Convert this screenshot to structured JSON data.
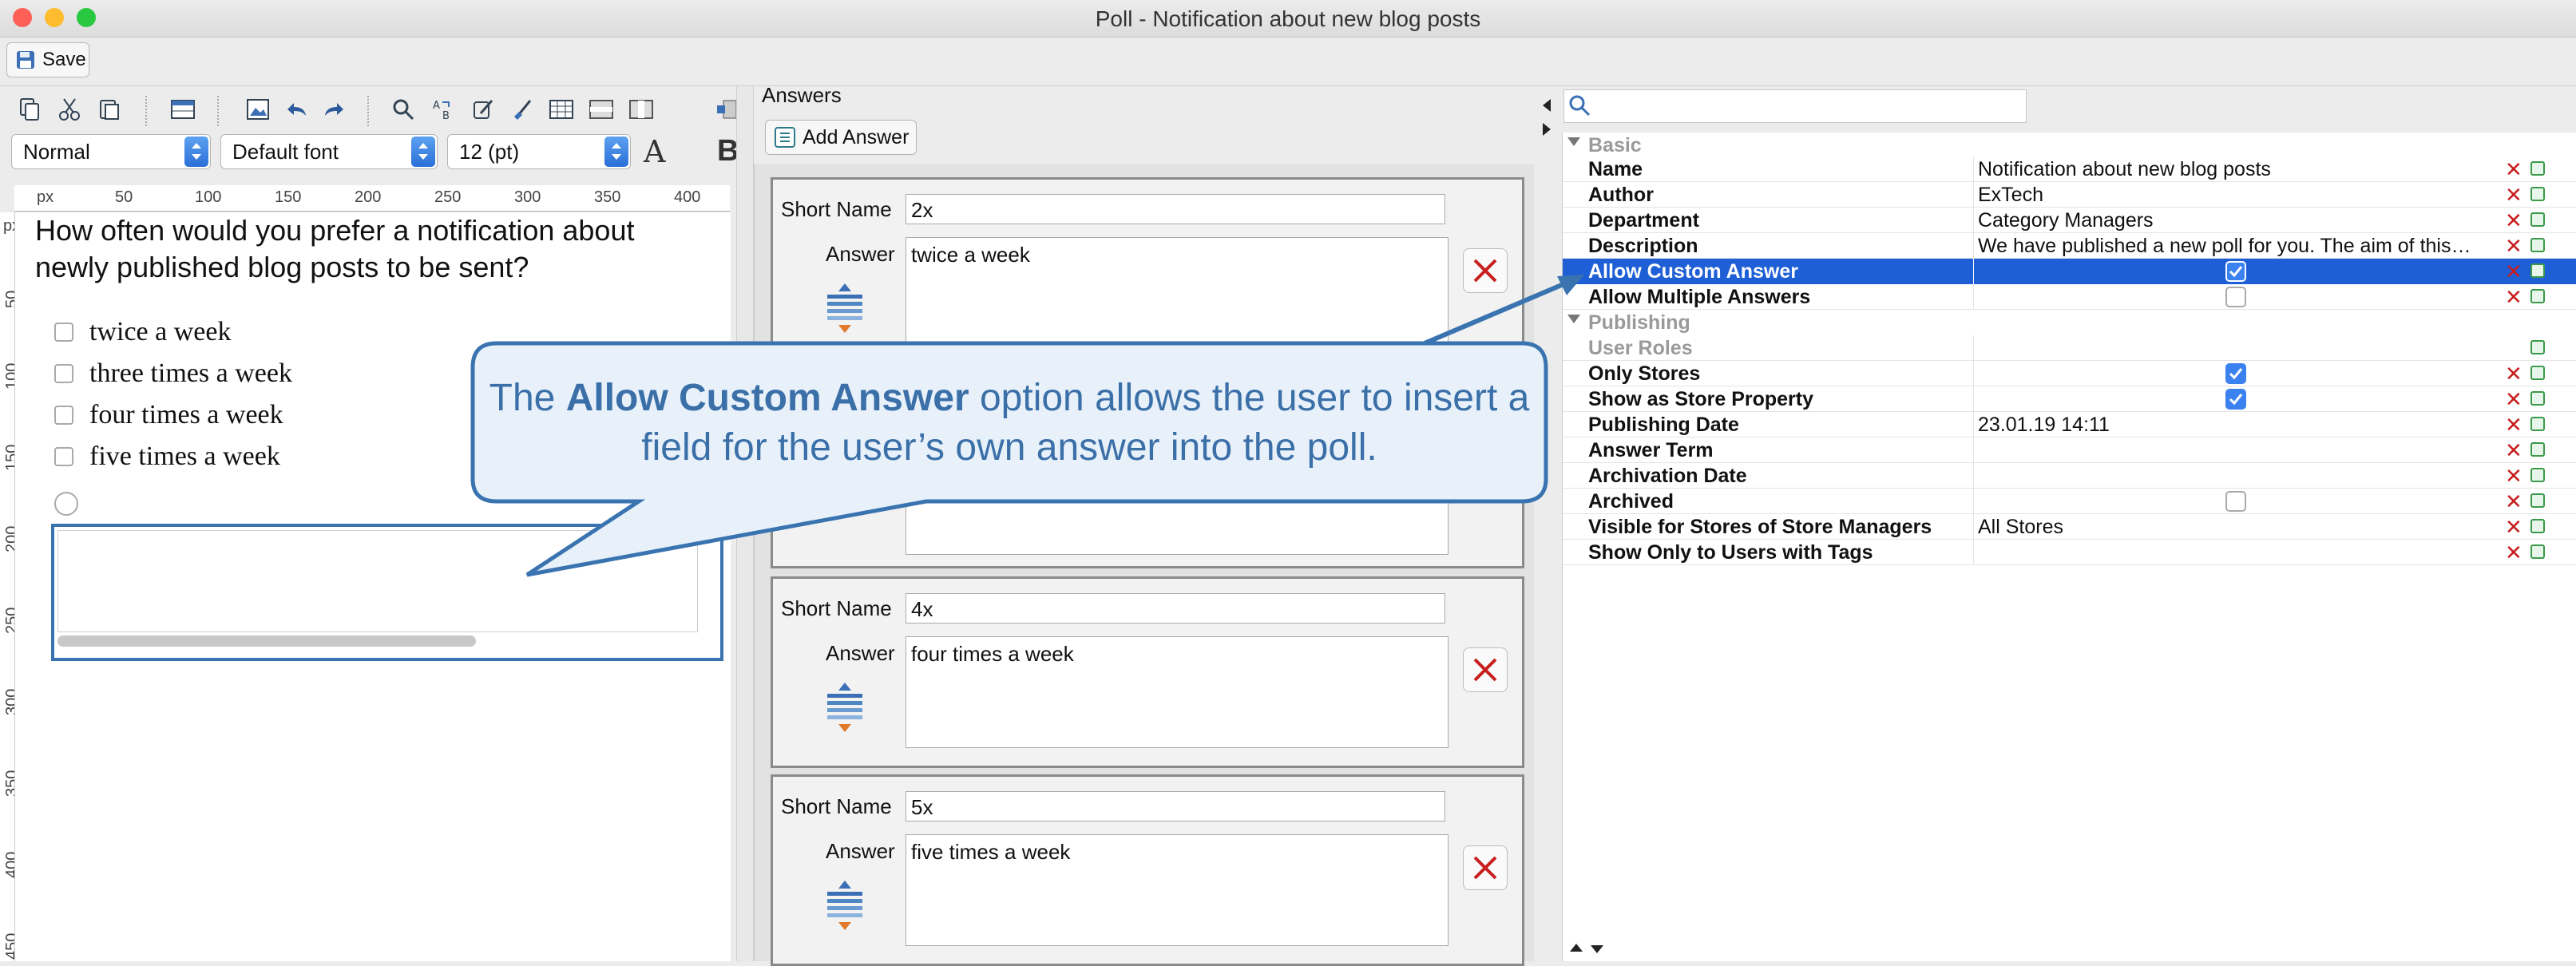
{
  "window": {
    "title": "Poll - Notification about new blog posts"
  },
  "toolbar": {
    "save_label": "Save",
    "style_select": "Normal",
    "font_select": "Default font",
    "size_select": "12 (pt)"
  },
  "editor": {
    "ruler_unit": "px",
    "ruler_top_ticks": [
      "50",
      "100",
      "150",
      "200",
      "250",
      "300",
      "350",
      "400"
    ],
    "ruler_left_ticks": [
      "50",
      "100",
      "150",
      "200",
      "250",
      "300",
      "350",
      "400",
      "450"
    ],
    "question": "How often would you prefer a notification about newly published blog posts to be sent?",
    "options": [
      "twice a week",
      "three times a week",
      "four times a week",
      "five times a week"
    ]
  },
  "answers": {
    "legend": "Answers",
    "add_label": "Add Answer",
    "short_name_label": "Short Name",
    "answer_label": "Answer",
    "items": [
      {
        "short_name": "2x",
        "answer": "twice a week"
      },
      {
        "short_name": "4x",
        "answer": "four times a week"
      },
      {
        "short_name": "5x",
        "answer": "five times a week"
      }
    ]
  },
  "properties": {
    "search_placeholder": "",
    "groups": [
      "Basic",
      "Publishing"
    ],
    "rows": [
      {
        "key": "Name",
        "value": "Notification about new blog posts"
      },
      {
        "key": "Author",
        "value": "ExTech"
      },
      {
        "key": "Department",
        "value": "Category Managers"
      },
      {
        "key": "Description",
        "value": "We have published a new poll for you. The aim of this…"
      },
      {
        "key": "Allow Custom Answer",
        "value": "",
        "checked": true,
        "selected": true
      },
      {
        "key": "Allow Multiple Answers",
        "value": "",
        "checked": false
      },
      {
        "key": "User Roles",
        "value": ""
      },
      {
        "key": "Only Stores",
        "value": "",
        "checked": true
      },
      {
        "key": "Show as Store Property",
        "value": "",
        "checked": true
      },
      {
        "key": "Publishing Date",
        "value": "23.01.19 14:11"
      },
      {
        "key": "Answer Term",
        "value": ""
      },
      {
        "key": "Archivation Date",
        "value": ""
      },
      {
        "key": "Archived",
        "value": "",
        "checked": false
      },
      {
        "key": "Visible for Stores of Store Managers",
        "value": "All Stores"
      },
      {
        "key": "Show Only to Users with Tags",
        "value": ""
      }
    ]
  },
  "callout": {
    "pre": "The ",
    "bold": "Allow Custom Answer",
    "post": " option allows the user to insert a field for the user’s own answer into the poll."
  },
  "colors": {
    "callout_border": "#3a74b0",
    "callout_fill": "#e8f1fa",
    "selection": "#1f5fd6",
    "delete_red": "#c81e1e"
  }
}
